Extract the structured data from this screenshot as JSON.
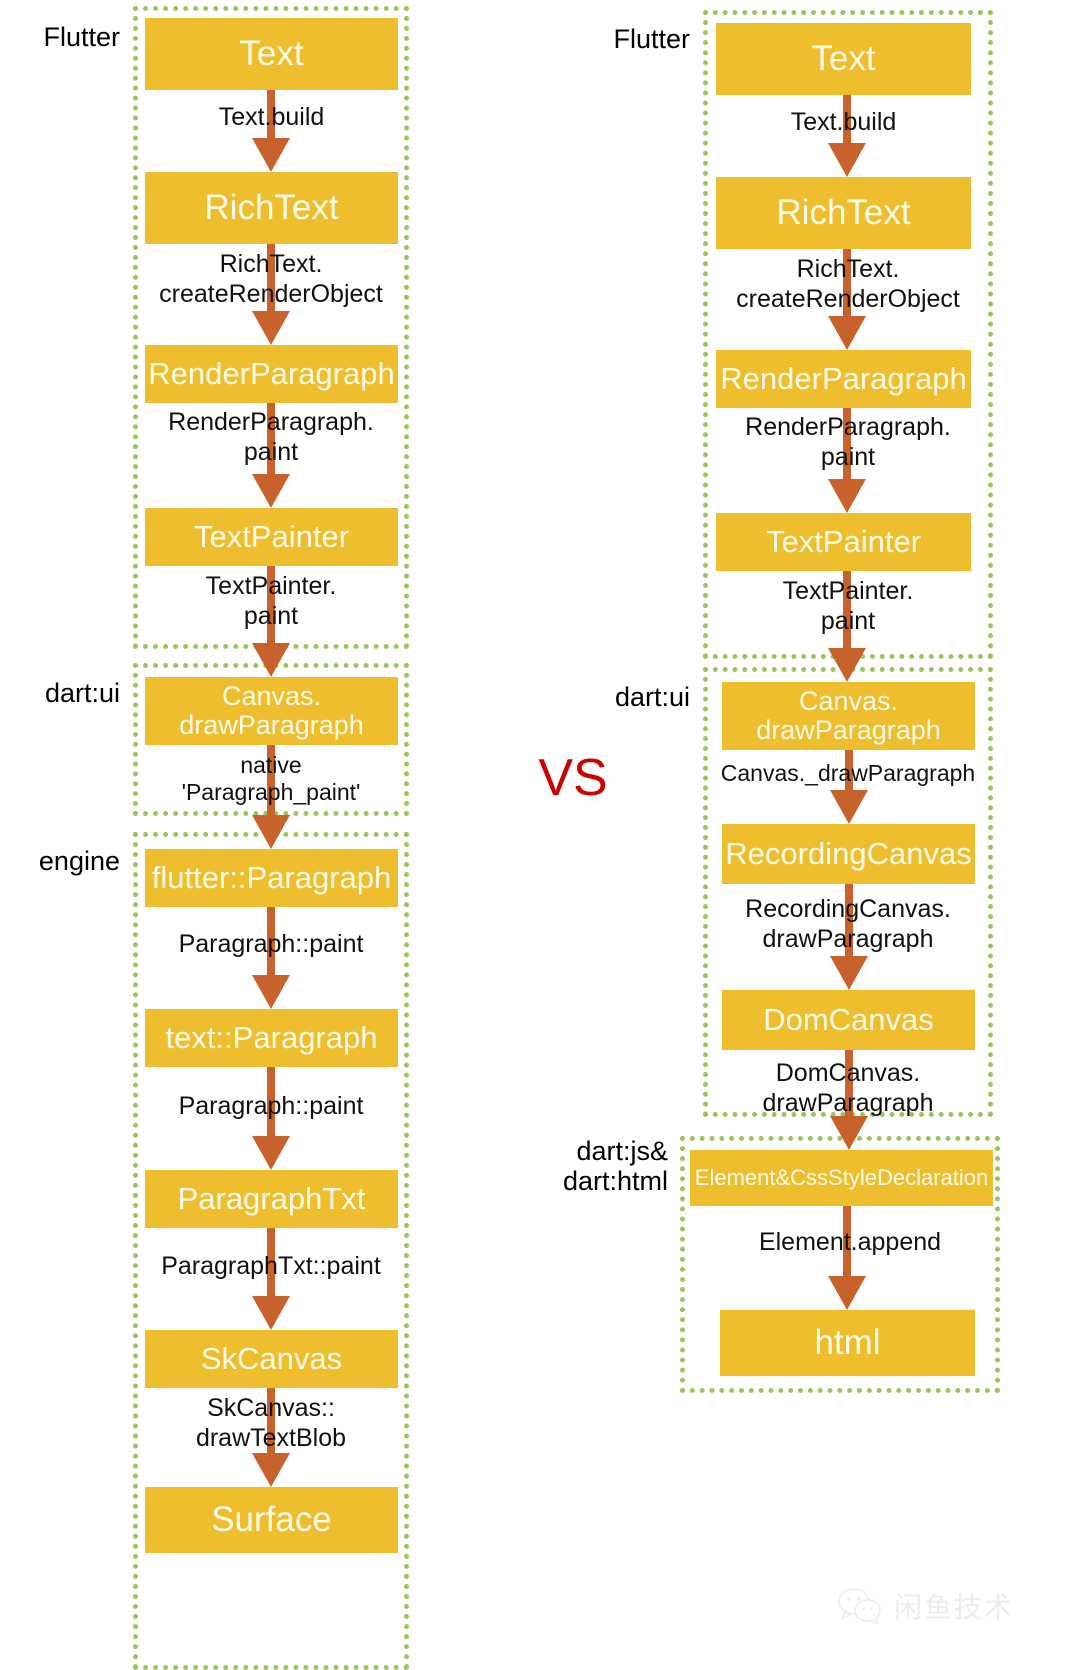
{
  "diagram": {
    "title": "Flutter text rendering pipeline: native VS web",
    "comparator": "VS",
    "colors": {
      "node_fill": "#efbe2e",
      "node_text": "#fffbe8",
      "group_border": "#9dc45a",
      "arrow": "#c8622c",
      "comparator": "#cc0000",
      "label_text": "#111111",
      "background": "#ffffff"
    }
  },
  "left_column": {
    "name": "native-pipeline",
    "groups": [
      {
        "label": "Flutter"
      },
      {
        "label": "dart:ui"
      },
      {
        "label": "engine"
      }
    ],
    "nodes": [
      {
        "id": "l-text",
        "label": "Text"
      },
      {
        "id": "l-richtext",
        "label": "RichText"
      },
      {
        "id": "l-renderparagraph",
        "label": "RenderParagraph"
      },
      {
        "id": "l-textpainter",
        "label": "TextPainter"
      },
      {
        "id": "l-canvas-drawpara",
        "label": "Canvas.\ndrawParagraph"
      },
      {
        "id": "l-flutter-paragraph",
        "label": "flutter::Paragraph"
      },
      {
        "id": "l-text-paragraph",
        "label": "text::Paragraph"
      },
      {
        "id": "l-paragraphtxt",
        "label": "ParagraphTxt"
      },
      {
        "id": "l-skcanvas",
        "label": "SkCanvas"
      },
      {
        "id": "l-surface",
        "label": "Surface"
      }
    ],
    "edges": [
      {
        "id": "l-e1",
        "label": "Text.build"
      },
      {
        "id": "l-e2",
        "label": "RichText.\ncreateRenderObject"
      },
      {
        "id": "l-e3",
        "label": "RenderParagraph.\npaint"
      },
      {
        "id": "l-e4",
        "label": "TextPainter.\npaint"
      },
      {
        "id": "l-e5",
        "label": "native\n'Paragraph_paint'"
      },
      {
        "id": "l-e6",
        "label": "Paragraph::paint"
      },
      {
        "id": "l-e7",
        "label": "Paragraph::paint"
      },
      {
        "id": "l-e8",
        "label": "ParagraphTxt::paint"
      },
      {
        "id": "l-e9",
        "label": "SkCanvas::\ndrawTextBlob"
      }
    ]
  },
  "right_column": {
    "name": "web-pipeline",
    "groups": [
      {
        "label": "Flutter"
      },
      {
        "label": "dart:ui"
      },
      {
        "label": "dart:js&\ndart:html"
      }
    ],
    "nodes": [
      {
        "id": "r-text",
        "label": "Text"
      },
      {
        "id": "r-richtext",
        "label": "RichText"
      },
      {
        "id": "r-renderparagraph",
        "label": "RenderParagraph"
      },
      {
        "id": "r-textpainter",
        "label": "TextPainter"
      },
      {
        "id": "r-canvas-drawpara",
        "label": "Canvas.\ndrawParagraph"
      },
      {
        "id": "r-recordingcanvas",
        "label": "RecordingCanvas"
      },
      {
        "id": "r-domcanvas",
        "label": "DomCanvas"
      },
      {
        "id": "r-element-css",
        "label": "Element&CssStyleDeclaration"
      },
      {
        "id": "r-html",
        "label": "html"
      }
    ],
    "edges": [
      {
        "id": "r-e1",
        "label": "Text.build"
      },
      {
        "id": "r-e2",
        "label": "RichText.\ncreateRenderObject"
      },
      {
        "id": "r-e3",
        "label": "RenderParagraph.\npaint"
      },
      {
        "id": "r-e4",
        "label": "TextPainter.\npaint"
      },
      {
        "id": "r-e5",
        "label": "Canvas._drawParagraph"
      },
      {
        "id": "r-e6",
        "label": "RecordingCanvas.\ndrawParagraph"
      },
      {
        "id": "r-e7",
        "label": "DomCanvas.\ndrawParagraph"
      },
      {
        "id": "r-e8",
        "label": "Element.append"
      }
    ]
  },
  "watermark": {
    "icon": "wechat-icon",
    "text": "闲鱼技术"
  }
}
